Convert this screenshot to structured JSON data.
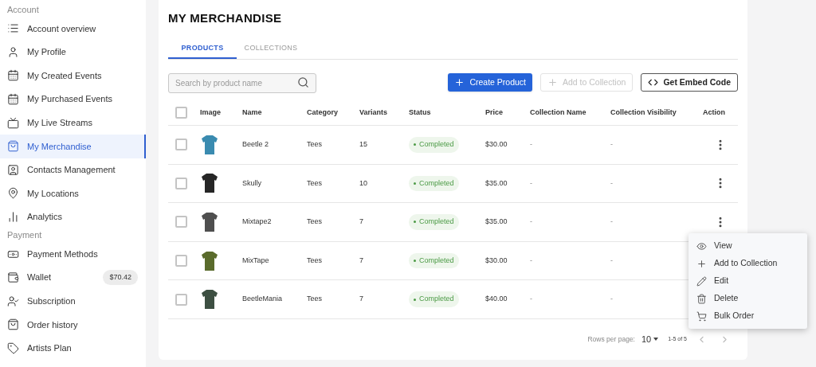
{
  "sidebar": {
    "sections": [
      {
        "title": "Account",
        "items": [
          {
            "label": "Account overview",
            "selected": false
          },
          {
            "label": "My Profile",
            "selected": false
          },
          {
            "label": "My Created Events",
            "selected": false
          },
          {
            "label": "My Purchased Events",
            "selected": false
          },
          {
            "label": "My Live Streams",
            "selected": false
          },
          {
            "label": "My Merchandise",
            "selected": true
          },
          {
            "label": "Contacts Management",
            "selected": false
          },
          {
            "label": "My Locations",
            "selected": false
          },
          {
            "label": "Analytics",
            "selected": false
          }
        ]
      },
      {
        "title": "Payment",
        "items": [
          {
            "label": "Payment Methods",
            "selected": false
          },
          {
            "label": "Wallet",
            "selected": false,
            "badge": "$70.42"
          },
          {
            "label": "Subscription",
            "selected": false
          },
          {
            "label": "Order history",
            "selected": false
          },
          {
            "label": "Artists Plan",
            "selected": false
          }
        ]
      }
    ]
  },
  "page": {
    "title": "MY MERCHANDISE",
    "tabs": [
      {
        "label": "PRODUCTS",
        "selected": true
      },
      {
        "label": "COLLECTIONS",
        "selected": false
      }
    ],
    "search": {
      "placeholder": "Search by product name"
    },
    "buttons": [
      {
        "label": "Create Product",
        "kind": "primary",
        "disabled": false
      },
      {
        "label": "Add to Collection",
        "kind": "add",
        "disabled": true
      },
      {
        "label": "Get Embed Code",
        "kind": "embed",
        "disabled": false
      }
    ],
    "table": {
      "header_checked": false,
      "columns": [
        "Image",
        "Name",
        "Category",
        "Variants",
        "Status",
        "Price",
        "Collection Name",
        "Collection Visibility",
        "Action"
      ],
      "rows": [
        {
          "checked": false,
          "color": "#3a8bb0",
          "name": "Beetle 2",
          "category": "Tees",
          "variants": "15",
          "status": "Completed",
          "price": "$30.00",
          "collection_name": "-",
          "collection_visibility": "-"
        },
        {
          "checked": false,
          "color": "#262626",
          "name": "Skully",
          "category": "Tees",
          "variants": "10",
          "status": "Completed",
          "price": "$35.00",
          "collection_name": "-",
          "collection_visibility": "-"
        },
        {
          "checked": false,
          "color": "#4f4f4f",
          "name": "Mixtape2",
          "category": "Tees",
          "variants": "7",
          "status": "Completed",
          "price": "$35.00",
          "collection_name": "-",
          "collection_visibility": "-"
        },
        {
          "checked": false,
          "color": "#5a6b2c",
          "name": "MixTape",
          "category": "Tees",
          "variants": "7",
          "status": "Completed",
          "price": "$30.00",
          "collection_name": "-",
          "collection_visibility": "-"
        },
        {
          "checked": false,
          "color": "#3d4f42",
          "name": "BeetleMania",
          "category": "Tees",
          "variants": "7",
          "status": "Completed",
          "price": "$40.00",
          "collection_name": "-",
          "collection_visibility": "-"
        }
      ]
    },
    "pagination": {
      "rows_per_page_label": "Rows per page:",
      "rows_per_page": "10",
      "range": "1-5 of 5"
    },
    "action_menu": {
      "items": [
        {
          "label": "View",
          "kind": "view"
        },
        {
          "label": "Add to Collection",
          "kind": "add"
        },
        {
          "label": "Edit",
          "kind": "edit"
        },
        {
          "label": "Delete",
          "kind": "delete"
        },
        {
          "label": "Bulk Order",
          "kind": "order"
        }
      ]
    }
  }
}
